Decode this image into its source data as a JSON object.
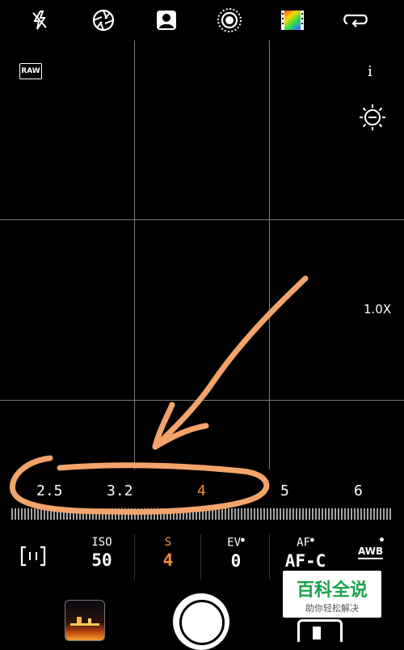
{
  "top_bar": {
    "icons": [
      "flash-off-icon",
      "aperture-icon",
      "portrait-icon",
      "live-photo-icon",
      "color-filter-icon",
      "loop-icon"
    ]
  },
  "overlay": {
    "raw_label": "RAW",
    "info_label": "i",
    "exposure_icon": "sun-minus-icon",
    "zoom": "1.0X"
  },
  "shutter_scale": {
    "values": [
      "2.5",
      "3.2",
      "4",
      "5",
      "6"
    ],
    "selected": "4"
  },
  "params": [
    {
      "label": "ISO",
      "value": "50",
      "active": false
    },
    {
      "label": "S",
      "value": "4",
      "active": true
    },
    {
      "label": "EV",
      "value": "0",
      "active": false
    },
    {
      "label": "AF",
      "value": "AF-C",
      "active": false
    }
  ],
  "awb_label": "AWB",
  "watermark": {
    "title": "百科全说",
    "subtitle": "助你轻松解决"
  },
  "colors": {
    "accent": "#f0903a",
    "annotation": "#f2a46a"
  }
}
